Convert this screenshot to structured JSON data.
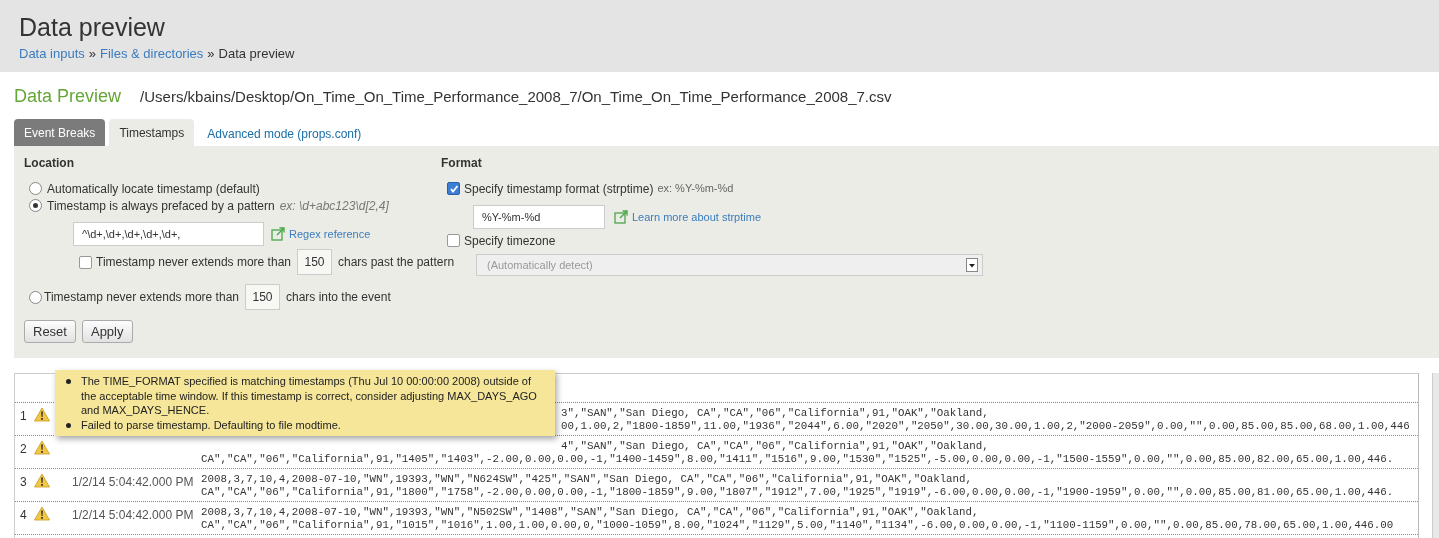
{
  "header": {
    "title": "Data preview",
    "breadcrumbs": [
      {
        "label": "Data inputs",
        "kind": "link"
      },
      {
        "label": "»",
        "kind": "separator"
      },
      {
        "label": "Files & directories",
        "kind": "link"
      },
      {
        "label": "»",
        "kind": "separator"
      },
      {
        "label": "Data preview",
        "kind": "current"
      }
    ]
  },
  "preview": {
    "title": "Data Preview",
    "path": "/Users/kbains/Desktop/On_Time_On_Time_Performance_2008_7/On_Time_On_Time_Performance_2008_7.csv"
  },
  "tabs": [
    {
      "label": "Event Breaks",
      "kind": "tab",
      "selected": false
    },
    {
      "label": "Timestamps",
      "kind": "tab",
      "selected": true
    },
    {
      "label": "Advanced mode (props.conf)",
      "kind": "link",
      "selected": false
    }
  ],
  "location": {
    "heading": "Location",
    "options": [
      {
        "label": "Automatically locate timestamp (default)",
        "kind": "plain",
        "selected": false
      },
      {
        "label": "Timestamp is always prefaced by a pattern",
        "example": "ex: \\d+abc123\\d[2,4]",
        "kind": "pattern",
        "selected": true,
        "value": "^\\d+,\\d+,\\d+,\\d+,\\d+,",
        "link": "Regex reference",
        "sub": {
          "checked": false,
          "label": "Timestamp never extends more than",
          "value": "150",
          "suffix": "chars past the pattern"
        }
      },
      {
        "label": "Timestamp never extends more than",
        "kind": "limit",
        "selected": false,
        "value": "150",
        "suffix": "chars into the event"
      }
    ]
  },
  "format": {
    "heading": "Format",
    "format_check": {
      "label": "Specify timestamp format (strptime)",
      "example": "ex: %Y-%m-%d",
      "checked": true,
      "value": "%Y-%m-%d",
      "link": "Learn more about strptime"
    },
    "timezone_check": {
      "label": "Specify timezone",
      "checked": false,
      "placeholder": "(Automatically detect)"
    }
  },
  "buttons": [
    "Reset",
    "Apply"
  ],
  "tooltip": {
    "items": [
      "The TIME_FORMAT specified is matching timestamps (Thu Jul 10 00:00:00 2008) outside of the acceptable time window. If this timestamp is correct, consider adjusting MAX_DAYS_AGO and MAX_DAYS_HENCE.",
      "Failed to parse timestamp. Defaulting to file modtime."
    ]
  },
  "rows": [
    {
      "number": "1",
      "warning": true,
      "lines": [
        {
          "text": "3\",\"SAN\",\"San Diego, CA\",\"CA\",\"06\",\"California\",91,\"OAK\",\"Oakland,",
          "obscured": true
        },
        {
          "text": "00,1.00,2,\"1800-1859\",11.00,\"1936\",\"2044\",6.00,\"2020\",\"2050\",30.00,30.00,1.00,2,\"2000-2059\",0.00,\"\",0.00,85.00,85.00,68.00,1.00,446",
          "obscured": true
        }
      ]
    },
    {
      "number": "2",
      "warning": true,
      "lines": [
        {
          "text": "4\",\"SAN\",\"San Diego, CA\",\"CA\",\"06\",\"California\",91,\"OAK\",\"Oakland,",
          "obscured": true
        },
        {
          "text": "CA\",\"CA\",\"06\",\"California\",91,\"1405\",\"1403\",-2.00,0.00,0.00,-1,\"1400-1459\",8.00,\"1411\",\"1516\",9.00,\"1530\",\"1525\",-5.00,0.00,0.00,-1,\"1500-1559\",0.00,\"\",0.00,85.00,82.00,65.00,1.00,446.",
          "obscured": false
        }
      ]
    },
    {
      "number": "3",
      "warning": true,
      "time": "1/2/14 5:04:42.000 PM",
      "lines": [
        {
          "text": "2008,3,7,10,4,2008-07-10,\"WN\",19393,\"WN\",\"N624SW\",\"425\",\"SAN\",\"San Diego, CA\",\"CA\",\"06\",\"California\",91,\"OAK\",\"Oakland,"
        },
        {
          "text": "CA\",\"CA\",\"06\",\"California\",91,\"1800\",\"1758\",-2.00,0.00,0.00,-1,\"1800-1859\",9.00,\"1807\",\"1912\",7.00,\"1925\",\"1919\",-6.00,0.00,0.00,-1,\"1900-1959\",0.00,\"\",0.00,85.00,81.00,65.00,1.00,446.",
          "obscured": false
        }
      ]
    },
    {
      "number": "4",
      "warning": true,
      "time": "1/2/14 5:04:42.000 PM",
      "lines": [
        {
          "text": "2008,3,7,10,4,2008-07-10,\"WN\",19393,\"WN\",\"N502SW\",\"1408\",\"SAN\",\"San Diego, CA\",\"CA\",\"06\",\"California\",91,\"OAK\",\"Oakland,"
        },
        {
          "text": "CA\",\"CA\",\"06\",\"California\",91,\"1015\",\"1016\",1.00,1.00,0.00,0,\"1000-1059\",8.00,\"1024\",\"1129\",5.00,\"1140\",\"1134\",-6.00,0.00,0.00,-1,\"1100-1159\",0.00,\"\",0.00,85.00,78.00,65.00,1.00,446.00",
          "obscured": false
        }
      ]
    }
  ]
}
